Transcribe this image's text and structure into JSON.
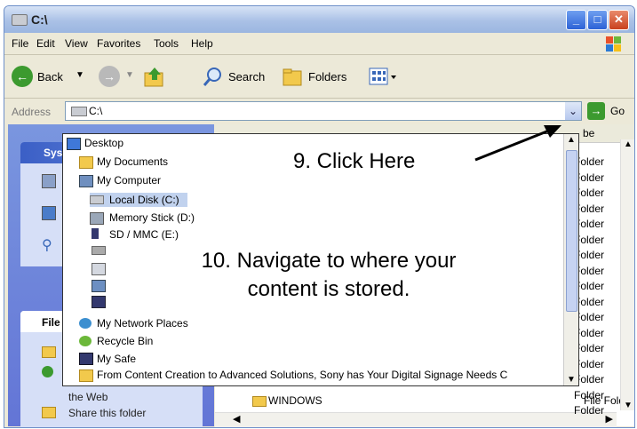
{
  "window": {
    "title": "C:\\"
  },
  "menu": [
    "File",
    "Edit",
    "View",
    "Favorites",
    "Tools",
    "Help"
  ],
  "toolbar": {
    "back": "Back",
    "search": "Search",
    "folders": "Folders"
  },
  "address": {
    "label": "Address",
    "value": "C:\\",
    "go": "Go"
  },
  "dropdown_items": [
    {
      "label": "Desktop"
    },
    {
      "label": "My Documents"
    },
    {
      "label": "My Computer"
    },
    {
      "label": "Local Disk (C:)"
    },
    {
      "label": "Memory Stick (D:)"
    },
    {
      "label": "SD / MMC (E:)"
    },
    {
      "label": "My Network Places"
    },
    {
      "label": "Recycle Bin"
    },
    {
      "label": "My Safe"
    },
    {
      "label": "From Content Creation to Advanced Solutions, Sony has Your Digital Signage Needs C"
    }
  ],
  "left_panel": {
    "system_tasks_header": "Syst",
    "file_tasks_header": "File",
    "web_text": "the Web",
    "share_text": "Share this folder"
  },
  "content": {
    "col_header": "be",
    "types": [
      "Folder",
      "Folder",
      "Folder",
      "Folder",
      "Folder",
      "Folder",
      "Folder",
      "Folder",
      "Folder",
      "Folder",
      "Folder",
      "Folder",
      "Folder",
      "Folder",
      "Folder",
      "Folder",
      "Folder"
    ],
    "windows_folder": "WINDOWS",
    "windows_type": "File Folder"
  },
  "callouts": {
    "step9": "9. Click Here",
    "step10_line1": "10. Navigate to where your",
    "step10_line2": "content is stored."
  }
}
